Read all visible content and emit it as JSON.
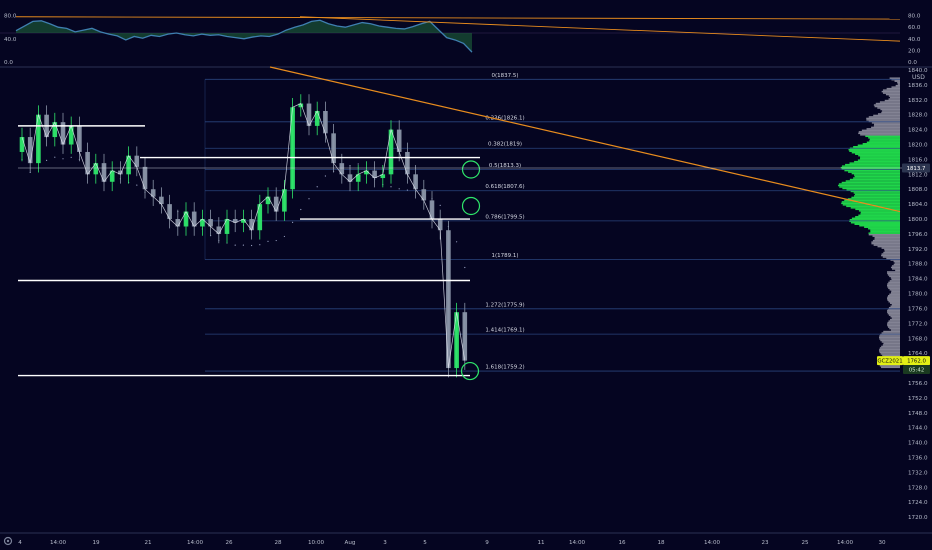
{
  "chart_data": [
    {
      "type": "line",
      "panel": "oscillator",
      "ylim": [
        0,
        100
      ],
      "y_ticks": [
        0.0,
        20.0,
        40.0,
        60.0,
        80.0
      ],
      "y_tick_labels": [
        "0.0",
        "20.0",
        "40.0",
        "60.0",
        "80.0"
      ],
      "left_tick_labels": [
        "80.0",
        "40.0",
        "0.0"
      ],
      "series": [
        {
          "values": [
            54,
            62,
            70,
            71,
            66,
            60,
            58,
            52,
            55,
            58,
            52,
            48,
            45,
            38,
            44,
            41,
            46,
            44,
            48,
            50,
            47,
            45,
            48,
            46,
            47,
            44,
            42,
            40,
            43,
            45,
            44,
            48,
            55,
            60,
            64,
            70,
            72,
            66,
            62,
            60,
            64,
            68,
            66,
            62,
            60,
            58,
            57,
            61,
            66,
            70,
            56,
            42,
            38,
            32,
            17
          ],
          "color": "#3f7fb0"
        }
      ],
      "grid": false
    },
    {
      "type": "candlestick",
      "panel": "price",
      "ylim": [
        1716,
        1840
      ],
      "x_tick_labels": [
        "4",
        "14:00",
        "19",
        "21",
        "14:00",
        "26",
        "28",
        "10:00",
        "Aug",
        "3",
        "5",
        "9",
        "11",
        "14:00",
        "16",
        "18",
        "14:00",
        "23",
        "25",
        "14:00",
        "30"
      ],
      "y_ticks": [
        1720,
        1724,
        1728,
        1732,
        1736,
        1740,
        1744,
        1748,
        1752,
        1756,
        1760,
        1764,
        1768,
        1772,
        1776,
        1780,
        1784,
        1788,
        1792,
        1796,
        1800,
        1804,
        1808,
        1812,
        1816,
        1820,
        1824,
        1828,
        1832,
        1836,
        1840
      ],
      "y_tick_labels": [
        "1720.0",
        "1724.0",
        "1728.0",
        "1732.0",
        "1736.0",
        "1740.0",
        "1744.0",
        "1748.0",
        "1752.0",
        "1756.0",
        "1760.0",
        "1764.0",
        "1768.0",
        "1772.0",
        "1776.0",
        "1780.0",
        "1784.0",
        "1788.0",
        "1792.0",
        "1796.0",
        "1800.0",
        "1804.0",
        "1808.0",
        "1812.0",
        "1816.0",
        "1820.0",
        "1824.0",
        "1828.0",
        "1832.0",
        "1836.0",
        "1840.0"
      ],
      "unit_label": "USD",
      "close": [
        1822,
        1815,
        1828,
        1822,
        1826,
        1820,
        1825,
        1818,
        1812,
        1815,
        1810,
        1813,
        1812,
        1817,
        1814,
        1808,
        1806,
        1804,
        1800,
        1798,
        1802,
        1798,
        1800,
        1798,
        1796,
        1800,
        1799,
        1800,
        1797,
        1804,
        1806,
        1802,
        1808,
        1830,
        1831,
        1825,
        1829,
        1823,
        1815,
        1812,
        1810,
        1812,
        1813,
        1811,
        1812,
        1824,
        1818,
        1812,
        1808,
        1805,
        1800,
        1797,
        1760,
        1775,
        1762
      ],
      "fib_levels": [
        {
          "label": "0(1837.5)",
          "value": 1837.5
        },
        {
          "label": "0.236(1826.1)",
          "value": 1826.1
        },
        {
          "label": "0.382(1819)",
          "value": 1819.0
        },
        {
          "label": "0.5(1813.3)",
          "value": 1813.3
        },
        {
          "label": "0.618(1807.6)",
          "value": 1807.6
        },
        {
          "label": "0.786(1799.5)",
          "value": 1799.5
        },
        {
          "label": "1(1789.1)",
          "value": 1789.1
        },
        {
          "label": "1.272(1775.9)",
          "value": 1775.9
        },
        {
          "label": "1.414(1769.1)",
          "value": 1769.1
        },
        {
          "label": "1.618(1759.2)",
          "value": 1759.2
        }
      ],
      "horizontal_levels": [
        1825.0,
        1816.5,
        1800.0,
        1783.5,
        1758.0
      ],
      "price_labels": [
        {
          "text": "1813.7",
          "value": 1813.7
        },
        {
          "text": "GCZ2021",
          "value": 1762.0
        },
        {
          "text": "1762.0",
          "value": 1762.0
        },
        {
          "text": "05:42",
          "value": 1759.6
        }
      ],
      "colors": {
        "background": "#050521",
        "up": "#2ee66a",
        "down": "#8a95a8",
        "trendline": "#e88c1e",
        "level_line": "#ffffff",
        "fib_line": "#2e4a86",
        "circle": "#2ee66a",
        "volume_profile_bright": "#22e04d",
        "volume_profile_dim": "#9a9aa8"
      },
      "grid": false
    }
  ]
}
